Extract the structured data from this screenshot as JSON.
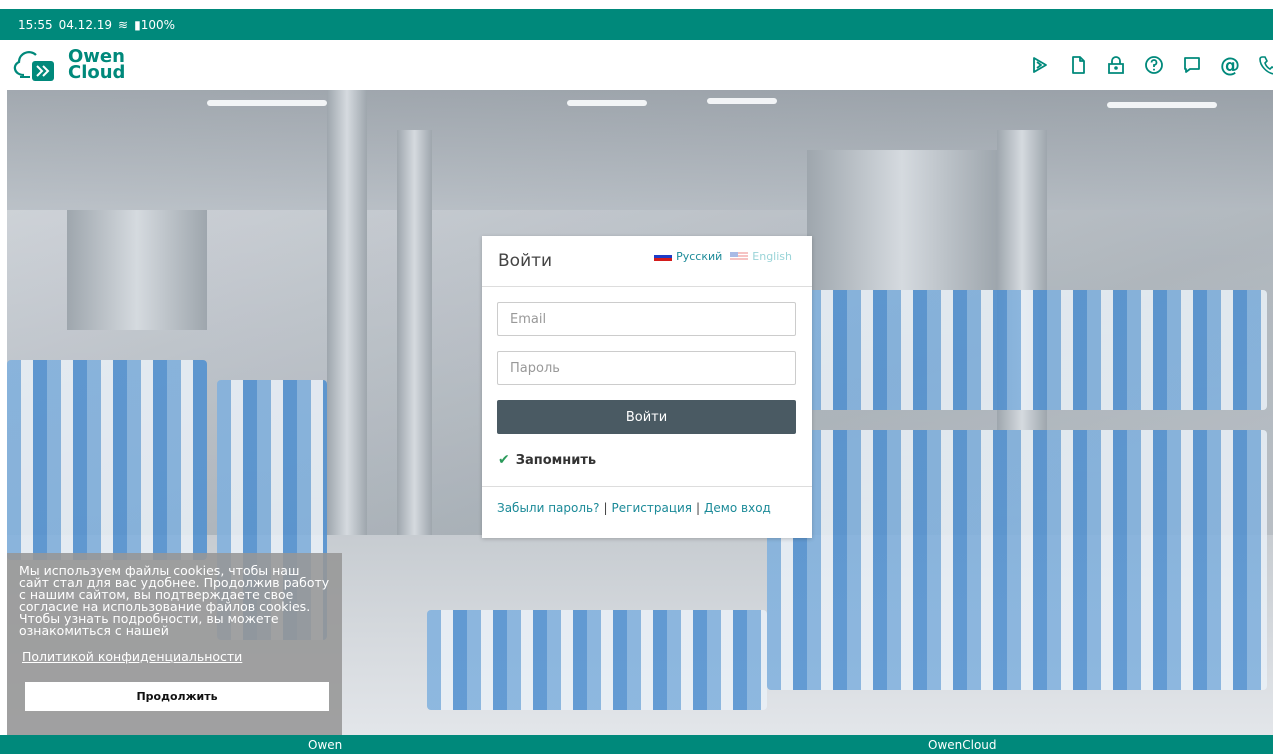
{
  "status_bar": {
    "time": "15:55",
    "date": "04.12.19",
    "battery": "100%"
  },
  "header": {
    "logo_line1": "Owen",
    "logo_line2": "Cloud",
    "icons": [
      "play-icon",
      "document-icon",
      "lock-icon",
      "help-icon",
      "chat-icon",
      "email-icon",
      "phone-icon"
    ],
    "at_symbol": "@"
  },
  "login": {
    "title": "Войти",
    "lang_ru": "Русский",
    "lang_en": "English",
    "email_placeholder": "Email",
    "password_placeholder": "Пароль",
    "submit_label": "Войти",
    "remember_label": "Запомнить",
    "forgot_link": "Забыли пароль?",
    "register_link": "Регистрация",
    "demo_link": "Демо вход",
    "separator": "|"
  },
  "cookie": {
    "text": "Мы используем файлы cookies, чтобы наш сайт стал для вас удобнее. Продолжив работу с нашим сайтом, вы подтверждаете свое согласие на использование файлов cookies. Чтобы узнать подробности, вы можете ознакомиться с нашей",
    "policy_link": "Политикой конфиденциальности",
    "continue_label": "Продолжить"
  },
  "footer": {
    "left": "Owen",
    "right": "OwenCloud"
  },
  "colors": {
    "brand": "#00897b",
    "link": "#1b8a98",
    "button": "#4a5a63"
  }
}
